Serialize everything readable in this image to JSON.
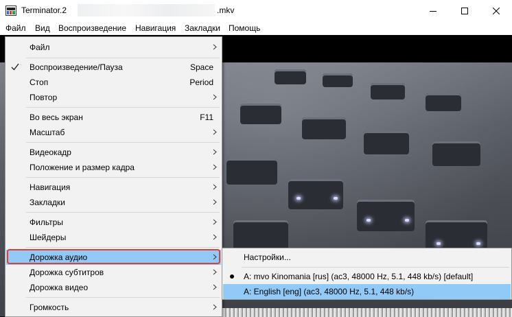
{
  "window": {
    "title_prefix": "Terminator.2",
    "title_suffix": ".mkv",
    "icons": [
      "app-icon",
      "minimize-icon",
      "maximize-icon",
      "close-icon"
    ]
  },
  "menubar": {
    "items": [
      "Файл",
      "Вид",
      "Воспроизведение",
      "Навигация",
      "Закладки",
      "Помощь"
    ]
  },
  "menu": {
    "items": [
      {
        "label": "Файл",
        "shortcut": "",
        "submenu": true
      },
      {
        "label": "Воспроизведение/Пауза",
        "shortcut": "Space",
        "checked": true
      },
      {
        "label": "Стоп",
        "shortcut": "Period"
      },
      {
        "label": "Повтор",
        "shortcut": "",
        "submenu": true
      },
      {
        "label": "Во весь экран",
        "shortcut": "F11"
      },
      {
        "label": "Масштаб",
        "shortcut": "",
        "submenu": true
      },
      {
        "label": "Видеокадр",
        "shortcut": "",
        "submenu": true
      },
      {
        "label": "Положение и размер кадра",
        "shortcut": "",
        "submenu": true
      },
      {
        "label": "Навигация",
        "shortcut": "",
        "submenu": true
      },
      {
        "label": "Закладки",
        "shortcut": "",
        "submenu": true
      },
      {
        "label": "Фильтры",
        "shortcut": "",
        "submenu": true
      },
      {
        "label": "Шейдеры",
        "shortcut": "",
        "submenu": true
      },
      {
        "label": "Дорожка аудио",
        "shortcut": "",
        "submenu": true,
        "highlighted": true
      },
      {
        "label": "Дорожка субтитров",
        "shortcut": "",
        "submenu": true
      },
      {
        "label": "Дорожка видео",
        "shortcut": "",
        "submenu": true
      },
      {
        "label": "Громкость",
        "shortcut": "",
        "submenu": true
      }
    ]
  },
  "audio_submenu": {
    "items": [
      {
        "label": "Настройки..."
      },
      {
        "label": "A: mvo Kinomania [rus] (ac3, 48000 Hz, 5.1, 448 kb/s) [default]",
        "selected": true
      },
      {
        "label": "A: English [eng] (ac3, 48000 Hz, 5.1, 448 kb/s)",
        "highlighted": true
      }
    ]
  },
  "colors": {
    "highlight": "#91c9f7",
    "outline": "#d9413a",
    "menu_bg": "#f2f2f2"
  }
}
